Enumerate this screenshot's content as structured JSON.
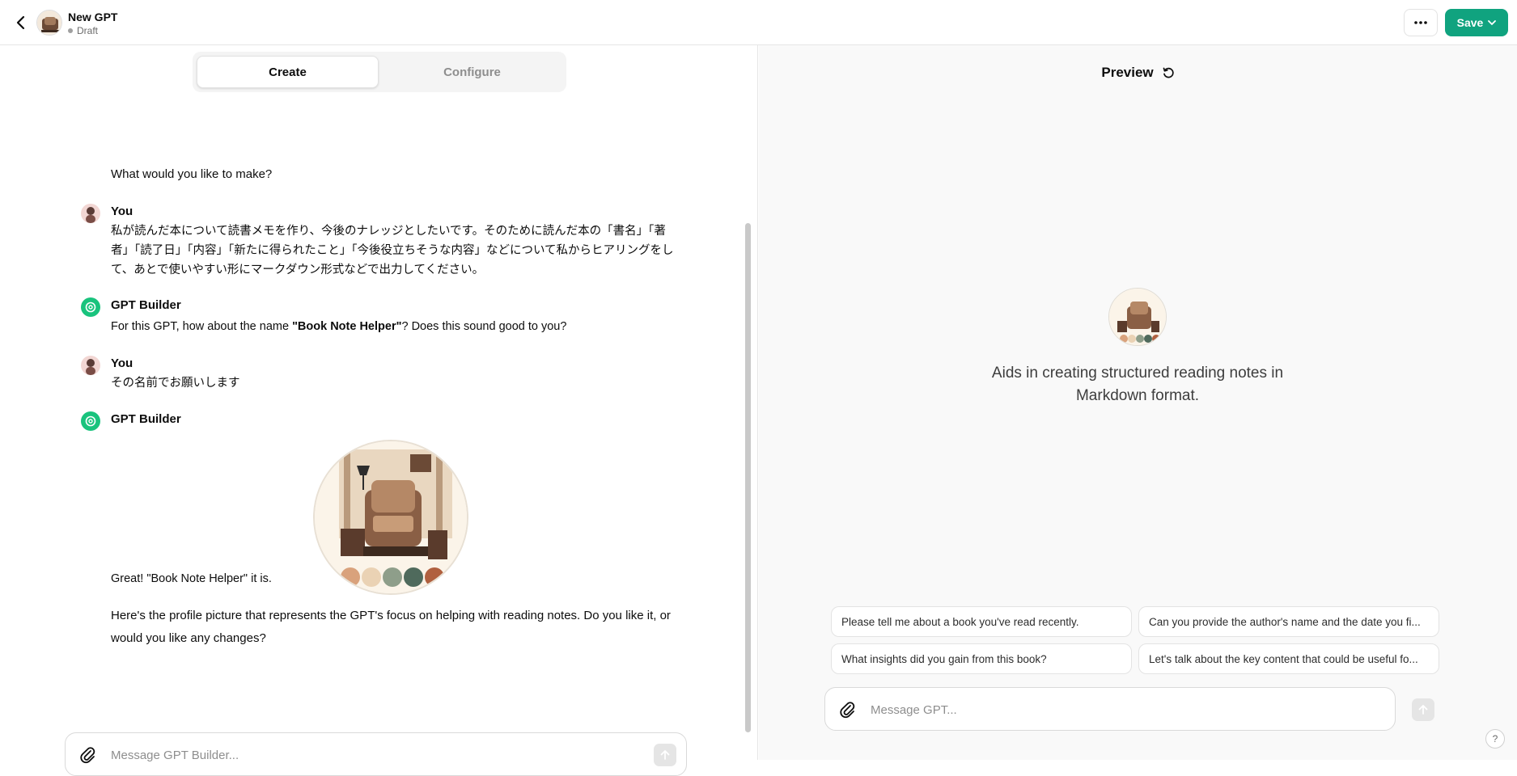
{
  "header": {
    "title": "New GPT",
    "status": "Draft",
    "save_label": "Save"
  },
  "tabs": [
    {
      "label": "Create",
      "active": true
    },
    {
      "label": "Configure",
      "active": false
    }
  ],
  "chat": {
    "intro": "What would you like to make?",
    "messages": [
      {
        "sender": "You",
        "text": "私が読んだ本について読書メモを作り、今後のナレッジとしたいです。そのために読んだ本の「書名」「著者」「読了日」「内容」「新たに得られたこと」「今後役立ちそうな内容」などについて私からヒアリングをして、あとで使いやすい形にマークダウン形式などで出力してください。"
      },
      {
        "sender": "GPT Builder",
        "text_pre": "For this GPT, how about the name ",
        "text_bold": "\"Book Note Helper\"",
        "text_post": "? Does this sound good to you?"
      },
      {
        "sender": "You",
        "text": "その名前でお願いします"
      },
      {
        "sender": "GPT Builder",
        "text": "Great! \"Book Note Helper\" it is.",
        "text2": "Here's the profile picture that represents the GPT's focus on helping with reading notes. Do you like it, or would you like any changes?"
      }
    ],
    "placeholder": "Message GPT Builder..."
  },
  "preview": {
    "title": "Preview",
    "description": "Aids in creating structured reading notes in Markdown format.",
    "starters": [
      "Please tell me about a book you've read recently.",
      "Can you provide the author's name and the date you fi...",
      "What insights did you gain from this book?",
      "Let's talk about the key content that could be useful fo..."
    ],
    "placeholder": "Message GPT...",
    "help": "?"
  },
  "colors": {
    "accent": "#10a37f",
    "builder_avatar": "#19c37d",
    "palette": [
      "#d9a27c",
      "#ead2b4",
      "#8e9e8a",
      "#4f6a5c",
      "#b0603f"
    ]
  }
}
